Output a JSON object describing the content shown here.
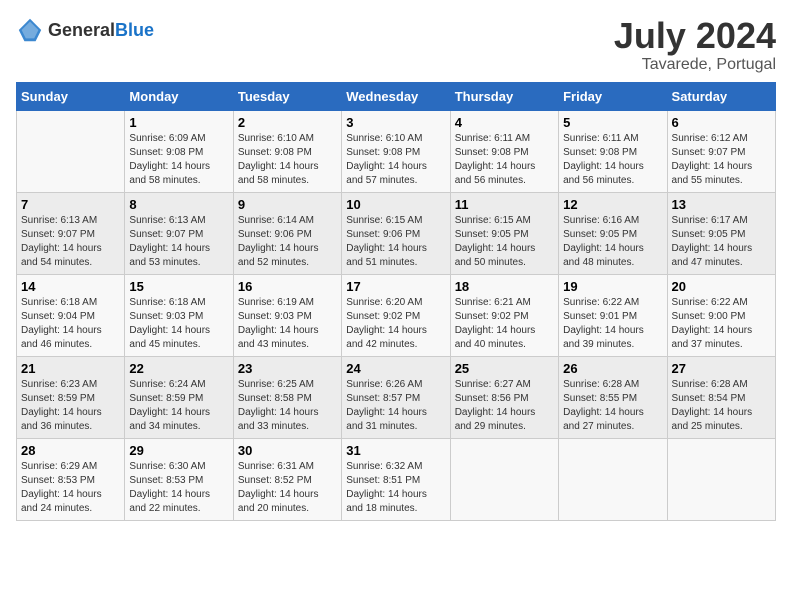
{
  "logo": {
    "text_general": "General",
    "text_blue": "Blue"
  },
  "header": {
    "title": "July 2024",
    "subtitle": "Tavarede, Portugal"
  },
  "calendar": {
    "days_of_week": [
      "Sunday",
      "Monday",
      "Tuesday",
      "Wednesday",
      "Thursday",
      "Friday",
      "Saturday"
    ],
    "weeks": [
      [
        {
          "day": "",
          "sunrise": "",
          "sunset": "",
          "daylight": ""
        },
        {
          "day": "1",
          "sunrise": "Sunrise: 6:09 AM",
          "sunset": "Sunset: 9:08 PM",
          "daylight": "Daylight: 14 hours and 58 minutes."
        },
        {
          "day": "2",
          "sunrise": "Sunrise: 6:10 AM",
          "sunset": "Sunset: 9:08 PM",
          "daylight": "Daylight: 14 hours and 58 minutes."
        },
        {
          "day": "3",
          "sunrise": "Sunrise: 6:10 AM",
          "sunset": "Sunset: 9:08 PM",
          "daylight": "Daylight: 14 hours and 57 minutes."
        },
        {
          "day": "4",
          "sunrise": "Sunrise: 6:11 AM",
          "sunset": "Sunset: 9:08 PM",
          "daylight": "Daylight: 14 hours and 56 minutes."
        },
        {
          "day": "5",
          "sunrise": "Sunrise: 6:11 AM",
          "sunset": "Sunset: 9:08 PM",
          "daylight": "Daylight: 14 hours and 56 minutes."
        },
        {
          "day": "6",
          "sunrise": "Sunrise: 6:12 AM",
          "sunset": "Sunset: 9:07 PM",
          "daylight": "Daylight: 14 hours and 55 minutes."
        }
      ],
      [
        {
          "day": "7",
          "sunrise": "Sunrise: 6:13 AM",
          "sunset": "Sunset: 9:07 PM",
          "daylight": "Daylight: 14 hours and 54 minutes."
        },
        {
          "day": "8",
          "sunrise": "Sunrise: 6:13 AM",
          "sunset": "Sunset: 9:07 PM",
          "daylight": "Daylight: 14 hours and 53 minutes."
        },
        {
          "day": "9",
          "sunrise": "Sunrise: 6:14 AM",
          "sunset": "Sunset: 9:06 PM",
          "daylight": "Daylight: 14 hours and 52 minutes."
        },
        {
          "day": "10",
          "sunrise": "Sunrise: 6:15 AM",
          "sunset": "Sunset: 9:06 PM",
          "daylight": "Daylight: 14 hours and 51 minutes."
        },
        {
          "day": "11",
          "sunrise": "Sunrise: 6:15 AM",
          "sunset": "Sunset: 9:05 PM",
          "daylight": "Daylight: 14 hours and 50 minutes."
        },
        {
          "day": "12",
          "sunrise": "Sunrise: 6:16 AM",
          "sunset": "Sunset: 9:05 PM",
          "daylight": "Daylight: 14 hours and 48 minutes."
        },
        {
          "day": "13",
          "sunrise": "Sunrise: 6:17 AM",
          "sunset": "Sunset: 9:05 PM",
          "daylight": "Daylight: 14 hours and 47 minutes."
        }
      ],
      [
        {
          "day": "14",
          "sunrise": "Sunrise: 6:18 AM",
          "sunset": "Sunset: 9:04 PM",
          "daylight": "Daylight: 14 hours and 46 minutes."
        },
        {
          "day": "15",
          "sunrise": "Sunrise: 6:18 AM",
          "sunset": "Sunset: 9:03 PM",
          "daylight": "Daylight: 14 hours and 45 minutes."
        },
        {
          "day": "16",
          "sunrise": "Sunrise: 6:19 AM",
          "sunset": "Sunset: 9:03 PM",
          "daylight": "Daylight: 14 hours and 43 minutes."
        },
        {
          "day": "17",
          "sunrise": "Sunrise: 6:20 AM",
          "sunset": "Sunset: 9:02 PM",
          "daylight": "Daylight: 14 hours and 42 minutes."
        },
        {
          "day": "18",
          "sunrise": "Sunrise: 6:21 AM",
          "sunset": "Sunset: 9:02 PM",
          "daylight": "Daylight: 14 hours and 40 minutes."
        },
        {
          "day": "19",
          "sunrise": "Sunrise: 6:22 AM",
          "sunset": "Sunset: 9:01 PM",
          "daylight": "Daylight: 14 hours and 39 minutes."
        },
        {
          "day": "20",
          "sunrise": "Sunrise: 6:22 AM",
          "sunset": "Sunset: 9:00 PM",
          "daylight": "Daylight: 14 hours and 37 minutes."
        }
      ],
      [
        {
          "day": "21",
          "sunrise": "Sunrise: 6:23 AM",
          "sunset": "Sunset: 8:59 PM",
          "daylight": "Daylight: 14 hours and 36 minutes."
        },
        {
          "day": "22",
          "sunrise": "Sunrise: 6:24 AM",
          "sunset": "Sunset: 8:59 PM",
          "daylight": "Daylight: 14 hours and 34 minutes."
        },
        {
          "day": "23",
          "sunrise": "Sunrise: 6:25 AM",
          "sunset": "Sunset: 8:58 PM",
          "daylight": "Daylight: 14 hours and 33 minutes."
        },
        {
          "day": "24",
          "sunrise": "Sunrise: 6:26 AM",
          "sunset": "Sunset: 8:57 PM",
          "daylight": "Daylight: 14 hours and 31 minutes."
        },
        {
          "day": "25",
          "sunrise": "Sunrise: 6:27 AM",
          "sunset": "Sunset: 8:56 PM",
          "daylight": "Daylight: 14 hours and 29 minutes."
        },
        {
          "day": "26",
          "sunrise": "Sunrise: 6:28 AM",
          "sunset": "Sunset: 8:55 PM",
          "daylight": "Daylight: 14 hours and 27 minutes."
        },
        {
          "day": "27",
          "sunrise": "Sunrise: 6:28 AM",
          "sunset": "Sunset: 8:54 PM",
          "daylight": "Daylight: 14 hours and 25 minutes."
        }
      ],
      [
        {
          "day": "28",
          "sunrise": "Sunrise: 6:29 AM",
          "sunset": "Sunset: 8:53 PM",
          "daylight": "Daylight: 14 hours and 24 minutes."
        },
        {
          "day": "29",
          "sunrise": "Sunrise: 6:30 AM",
          "sunset": "Sunset: 8:53 PM",
          "daylight": "Daylight: 14 hours and 22 minutes."
        },
        {
          "day": "30",
          "sunrise": "Sunrise: 6:31 AM",
          "sunset": "Sunset: 8:52 PM",
          "daylight": "Daylight: 14 hours and 20 minutes."
        },
        {
          "day": "31",
          "sunrise": "Sunrise: 6:32 AM",
          "sunset": "Sunset: 8:51 PM",
          "daylight": "Daylight: 14 hours and 18 minutes."
        },
        {
          "day": "",
          "sunrise": "",
          "sunset": "",
          "daylight": ""
        },
        {
          "day": "",
          "sunrise": "",
          "sunset": "",
          "daylight": ""
        },
        {
          "day": "",
          "sunrise": "",
          "sunset": "",
          "daylight": ""
        }
      ]
    ]
  }
}
